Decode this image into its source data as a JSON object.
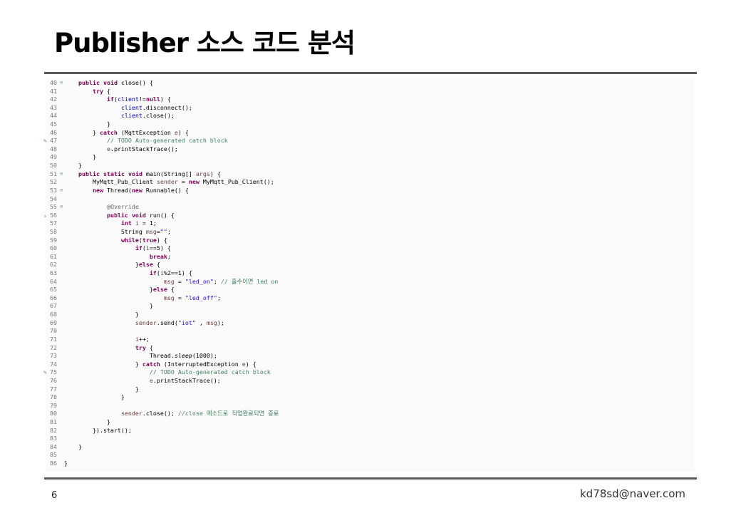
{
  "slide": {
    "title": "Publisher 소스 코드 분석",
    "page_number": "6",
    "email": "kd78sd@naver.com"
  },
  "code_lines": [
    {
      "n": "40",
      "mark": "⊖",
      "segs": [
        {
          "t": "    "
        },
        {
          "t": "public",
          "c": "kw"
        },
        {
          "t": " "
        },
        {
          "t": "void",
          "c": "kw"
        },
        {
          "t": " close() {"
        }
      ]
    },
    {
      "n": "41",
      "segs": [
        {
          "t": "        "
        },
        {
          "t": "try",
          "c": "kw"
        },
        {
          "t": " {"
        }
      ]
    },
    {
      "n": "42",
      "segs": [
        {
          "t": "            "
        },
        {
          "t": "if",
          "c": "kw"
        },
        {
          "t": "("
        },
        {
          "t": "client",
          "c": "fld"
        },
        {
          "t": "!="
        },
        {
          "t": "null",
          "c": "kw"
        },
        {
          "t": ") {"
        }
      ]
    },
    {
      "n": "43",
      "segs": [
        {
          "t": "                "
        },
        {
          "t": "client",
          "c": "fld"
        },
        {
          "t": ".disconnect();"
        }
      ]
    },
    {
      "n": "44",
      "segs": [
        {
          "t": "                "
        },
        {
          "t": "client",
          "c": "fld"
        },
        {
          "t": ".close();"
        }
      ]
    },
    {
      "n": "45",
      "segs": [
        {
          "t": "            }"
        }
      ]
    },
    {
      "n": "46",
      "segs": [
        {
          "t": "        } "
        },
        {
          "t": "catch",
          "c": "kw"
        },
        {
          "t": " (MqttException "
        },
        {
          "t": "e",
          "c": "var"
        },
        {
          "t": ") {"
        }
      ]
    },
    {
      "n": "47",
      "left": "✎",
      "segs": [
        {
          "t": "            "
        },
        {
          "t": "// TODO Auto-generated catch block",
          "c": "cm"
        }
      ]
    },
    {
      "n": "48",
      "segs": [
        {
          "t": "            "
        },
        {
          "t": "e",
          "c": "var"
        },
        {
          "t": ".printStackTrace();"
        }
      ]
    },
    {
      "n": "49",
      "segs": [
        {
          "t": "        }"
        }
      ]
    },
    {
      "n": "50",
      "segs": [
        {
          "t": "    }"
        }
      ]
    },
    {
      "n": "51",
      "mark": "⊖",
      "segs": [
        {
          "t": "    "
        },
        {
          "t": "public",
          "c": "kw"
        },
        {
          "t": " "
        },
        {
          "t": "static",
          "c": "kw"
        },
        {
          "t": " "
        },
        {
          "t": "void",
          "c": "kw"
        },
        {
          "t": " main(String[] "
        },
        {
          "t": "args",
          "c": "var"
        },
        {
          "t": ") {"
        }
      ]
    },
    {
      "n": "52",
      "segs": [
        {
          "t": "        MyMqtt_Pub_Client "
        },
        {
          "t": "sender",
          "c": "var"
        },
        {
          "t": " = "
        },
        {
          "t": "new",
          "c": "kw"
        },
        {
          "t": " MyMqtt_Pub_Client();"
        }
      ]
    },
    {
      "n": "53",
      "mark": "⊖",
      "segs": [
        {
          "t": "        "
        },
        {
          "t": "new",
          "c": "kw"
        },
        {
          "t": " Thread("
        },
        {
          "t": "new",
          "c": "kw"
        },
        {
          "t": " Runnable() {"
        }
      ]
    },
    {
      "n": "54",
      "segs": [
        {
          "t": ""
        }
      ]
    },
    {
      "n": "55",
      "mark": "⊖",
      "segs": [
        {
          "t": "            "
        },
        {
          "t": "@Override",
          "c": "ann"
        }
      ]
    },
    {
      "n": "56",
      "left": "▵",
      "segs": [
        {
          "t": "            "
        },
        {
          "t": "public",
          "c": "kw"
        },
        {
          "t": " "
        },
        {
          "t": "void",
          "c": "kw"
        },
        {
          "t": " run() {"
        }
      ]
    },
    {
      "n": "57",
      "segs": [
        {
          "t": "                "
        },
        {
          "t": "int",
          "c": "kw"
        },
        {
          "t": " "
        },
        {
          "t": "i",
          "c": "var"
        },
        {
          "t": " = 1;"
        }
      ]
    },
    {
      "n": "58",
      "segs": [
        {
          "t": "                String "
        },
        {
          "t": "msg",
          "c": "var"
        },
        {
          "t": "="
        },
        {
          "t": "\"\"",
          "c": "str"
        },
        {
          "t": ";"
        }
      ]
    },
    {
      "n": "59",
      "segs": [
        {
          "t": "                "
        },
        {
          "t": "while",
          "c": "kw"
        },
        {
          "t": "("
        },
        {
          "t": "true",
          "c": "kw"
        },
        {
          "t": ") {"
        }
      ]
    },
    {
      "n": "60",
      "segs": [
        {
          "t": "                    "
        },
        {
          "t": "if",
          "c": "kw"
        },
        {
          "t": "("
        },
        {
          "t": "i",
          "c": "var"
        },
        {
          "t": "==5) {"
        }
      ]
    },
    {
      "n": "61",
      "segs": [
        {
          "t": "                        "
        },
        {
          "t": "break",
          "c": "kw"
        },
        {
          "t": ";"
        }
      ]
    },
    {
      "n": "62",
      "segs": [
        {
          "t": "                    }"
        },
        {
          "t": "else",
          "c": "kw"
        },
        {
          "t": " {"
        }
      ]
    },
    {
      "n": "63",
      "segs": [
        {
          "t": "                        "
        },
        {
          "t": "if",
          "c": "kw"
        },
        {
          "t": "("
        },
        {
          "t": "i",
          "c": "var"
        },
        {
          "t": "%2==1) {"
        }
      ]
    },
    {
      "n": "64",
      "segs": [
        {
          "t": "                            "
        },
        {
          "t": "msg",
          "c": "var"
        },
        {
          "t": " = "
        },
        {
          "t": "\"led_on\"",
          "c": "str"
        },
        {
          "t": "; "
        },
        {
          "t": "// 홀수이면 led on",
          "c": "cm"
        }
      ]
    },
    {
      "n": "65",
      "segs": [
        {
          "t": "                        }"
        },
        {
          "t": "else",
          "c": "kw"
        },
        {
          "t": " {"
        }
      ]
    },
    {
      "n": "66",
      "segs": [
        {
          "t": "                            "
        },
        {
          "t": "msg",
          "c": "var"
        },
        {
          "t": " = "
        },
        {
          "t": "\"led_off\"",
          "c": "str"
        },
        {
          "t": ";"
        }
      ]
    },
    {
      "n": "67",
      "segs": [
        {
          "t": "                        }"
        }
      ]
    },
    {
      "n": "68",
      "segs": [
        {
          "t": "                    }"
        }
      ]
    },
    {
      "n": "69",
      "segs": [
        {
          "t": "                    "
        },
        {
          "t": "sender",
          "c": "var"
        },
        {
          "t": ".send("
        },
        {
          "t": "\"iot\"",
          "c": "str"
        },
        {
          "t": " , "
        },
        {
          "t": "msg",
          "c": "var"
        },
        {
          "t": ");"
        }
      ]
    },
    {
      "n": "70",
      "segs": [
        {
          "t": ""
        }
      ]
    },
    {
      "n": "71",
      "segs": [
        {
          "t": "                    "
        },
        {
          "t": "i",
          "c": "var"
        },
        {
          "t": "++;"
        }
      ]
    },
    {
      "n": "72",
      "segs": [
        {
          "t": "                    "
        },
        {
          "t": "try",
          "c": "kw"
        },
        {
          "t": " {"
        }
      ]
    },
    {
      "n": "73",
      "segs": [
        {
          "t": "                        Thread."
        },
        {
          "t": "sleep",
          "c": "it"
        },
        {
          "t": "(1000);"
        }
      ]
    },
    {
      "n": "74",
      "segs": [
        {
          "t": "                    } "
        },
        {
          "t": "catch",
          "c": "kw"
        },
        {
          "t": " (InterruptedException "
        },
        {
          "t": "e",
          "c": "var"
        },
        {
          "t": ") {"
        }
      ]
    },
    {
      "n": "75",
      "left": "✎",
      "segs": [
        {
          "t": "                        "
        },
        {
          "t": "// TODO Auto-generated catch block",
          "c": "cm"
        }
      ]
    },
    {
      "n": "76",
      "segs": [
        {
          "t": "                        "
        },
        {
          "t": "e",
          "c": "var"
        },
        {
          "t": ".printStackTrace();"
        }
      ]
    },
    {
      "n": "77",
      "segs": [
        {
          "t": "                    }"
        }
      ]
    },
    {
      "n": "78",
      "segs": [
        {
          "t": "                }"
        }
      ]
    },
    {
      "n": "79",
      "segs": [
        {
          "t": ""
        }
      ]
    },
    {
      "n": "80",
      "segs": [
        {
          "t": "                "
        },
        {
          "t": "sender",
          "c": "var"
        },
        {
          "t": ".close(); "
        },
        {
          "t": "//close 메소드로 작업완료되면 종료",
          "c": "cm"
        }
      ]
    },
    {
      "n": "81",
      "segs": [
        {
          "t": "            }"
        }
      ]
    },
    {
      "n": "82",
      "segs": [
        {
          "t": "        }).start();"
        }
      ]
    },
    {
      "n": "83",
      "segs": [
        {
          "t": ""
        }
      ]
    },
    {
      "n": "84",
      "segs": [
        {
          "t": "    }"
        }
      ]
    },
    {
      "n": "85",
      "segs": [
        {
          "t": ""
        }
      ]
    },
    {
      "n": "86",
      "segs": [
        {
          "t": "}"
        }
      ]
    }
  ]
}
